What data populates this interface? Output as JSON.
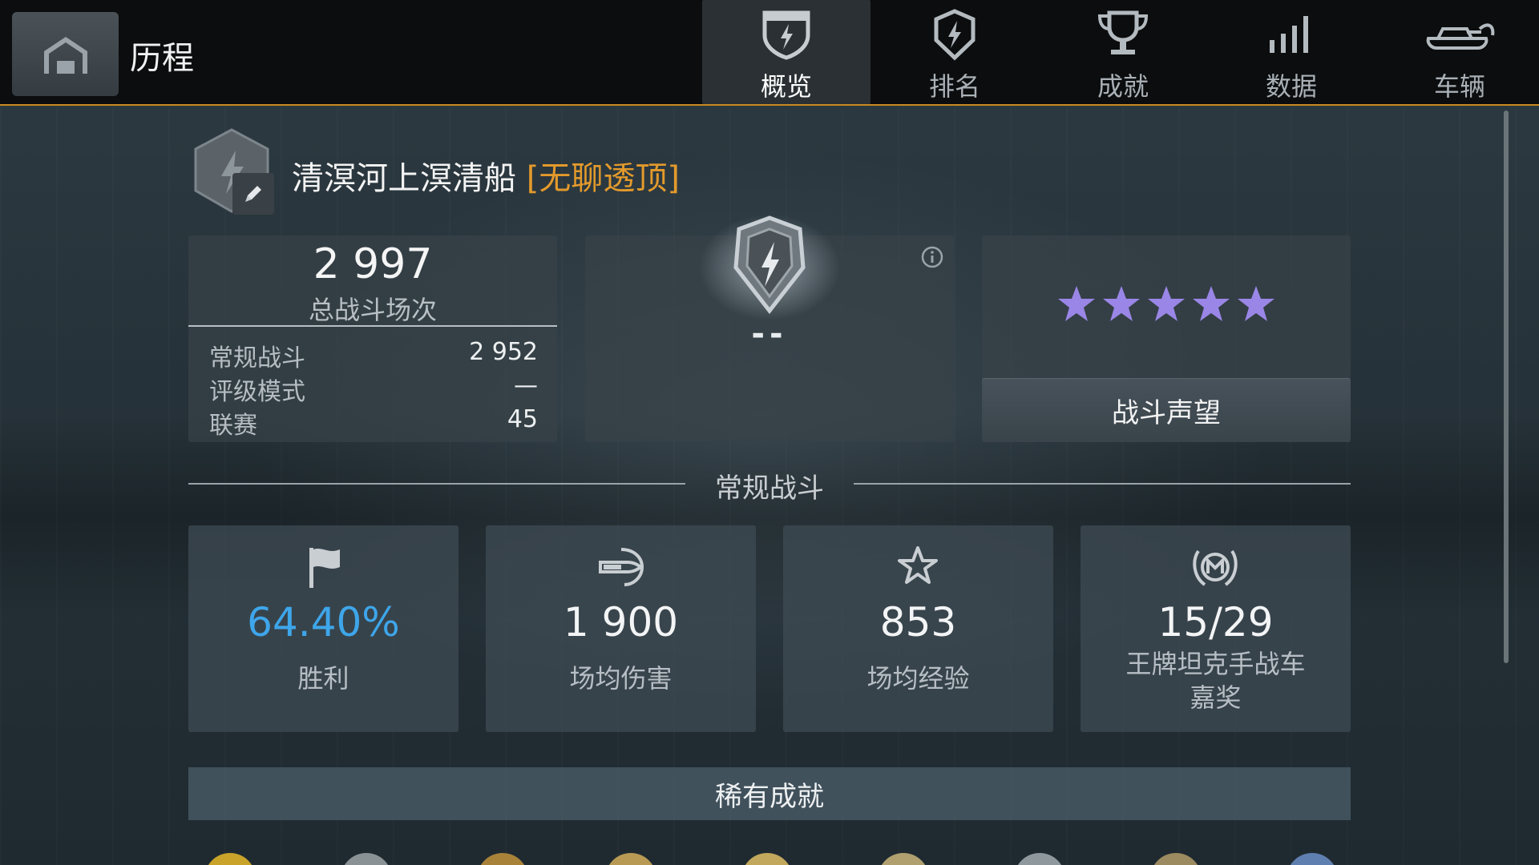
{
  "header": {
    "title": "历程"
  },
  "tabs": [
    {
      "label": "概览",
      "icon": "shield-icon",
      "active": true
    },
    {
      "label": "排名",
      "icon": "rank-icon",
      "active": false
    },
    {
      "label": "成就",
      "icon": "trophy-icon",
      "active": false
    },
    {
      "label": "数据",
      "icon": "bar-chart-icon",
      "active": false
    },
    {
      "label": "车辆",
      "icon": "tank-icon",
      "active": false
    }
  ],
  "player": {
    "name": "清溟河上溟清船",
    "clan": "[无聊透顶]"
  },
  "battles": {
    "total": "2 997",
    "total_label": "总战斗场次",
    "rows": [
      {
        "label": "常规战斗",
        "value": "2 952"
      },
      {
        "label": "评级模式",
        "value": "—"
      },
      {
        "label": "联赛",
        "value": "45"
      }
    ]
  },
  "rank": {
    "value": "--"
  },
  "prestige": {
    "stars": 5,
    "button_label": "战斗声望",
    "star_color": "#9a86e6"
  },
  "section": {
    "title": "常规战斗"
  },
  "stats": [
    {
      "icon": "flag-icon",
      "value": "64.40%",
      "label": "胜利"
    },
    {
      "icon": "shell-icon",
      "value": "1 900",
      "label": "场均伤害"
    },
    {
      "icon": "star-outline-icon",
      "value": "853",
      "label": "场均经验"
    },
    {
      "icon": "mastery-badge-icon",
      "value": "15/29",
      "label": "王牌坦克手战车嘉奖"
    }
  ],
  "rare_achievements": {
    "title": "稀有成就"
  },
  "colors": {
    "accent": "#c98a1f",
    "win": "#3ea6ea",
    "clan": "#e39a2c"
  }
}
